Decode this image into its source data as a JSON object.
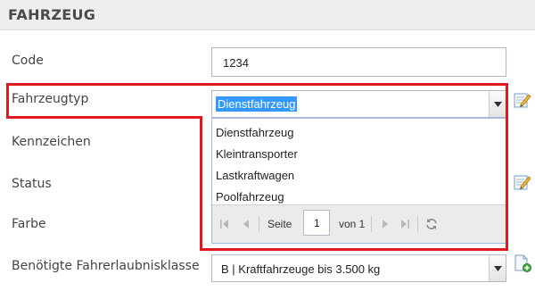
{
  "header": {
    "title": "FAHRZEUG"
  },
  "form": {
    "code": {
      "label": "Code",
      "value": "1234"
    },
    "fahrzeugtyp": {
      "label": "Fahrzeugtyp",
      "value": "Dienstfahrzeug"
    },
    "kennzeichen": {
      "label": "Kennzeichen"
    },
    "status": {
      "label": "Status"
    },
    "farbe": {
      "label": "Farbe"
    },
    "fahrerlaubnis": {
      "label": "Benötigte Fahrerlaubnisklasse",
      "value": "B | Kraftfahrzeuge bis 3.500 kg"
    }
  },
  "dropdown": {
    "options": [
      "Dienstfahrzeug",
      "Kleintransporter",
      "Lastkraftwagen",
      "Poolfahrzeug"
    ],
    "pager": {
      "page_label": "Seite",
      "current_page": "1",
      "of_label": "von 1"
    }
  },
  "icons": {
    "edit": "edit-pencil-icon",
    "add": "add-document-icon",
    "combo_arrow": "chevron-down-icon",
    "first": "first-page-icon",
    "prev": "prev-page-icon",
    "next": "next-page-icon",
    "last": "last-page-icon",
    "refresh": "refresh-icon"
  },
  "colors": {
    "highlight": "#e0191f",
    "selection": "#3399ff",
    "header_bg": "#eeeeee"
  }
}
